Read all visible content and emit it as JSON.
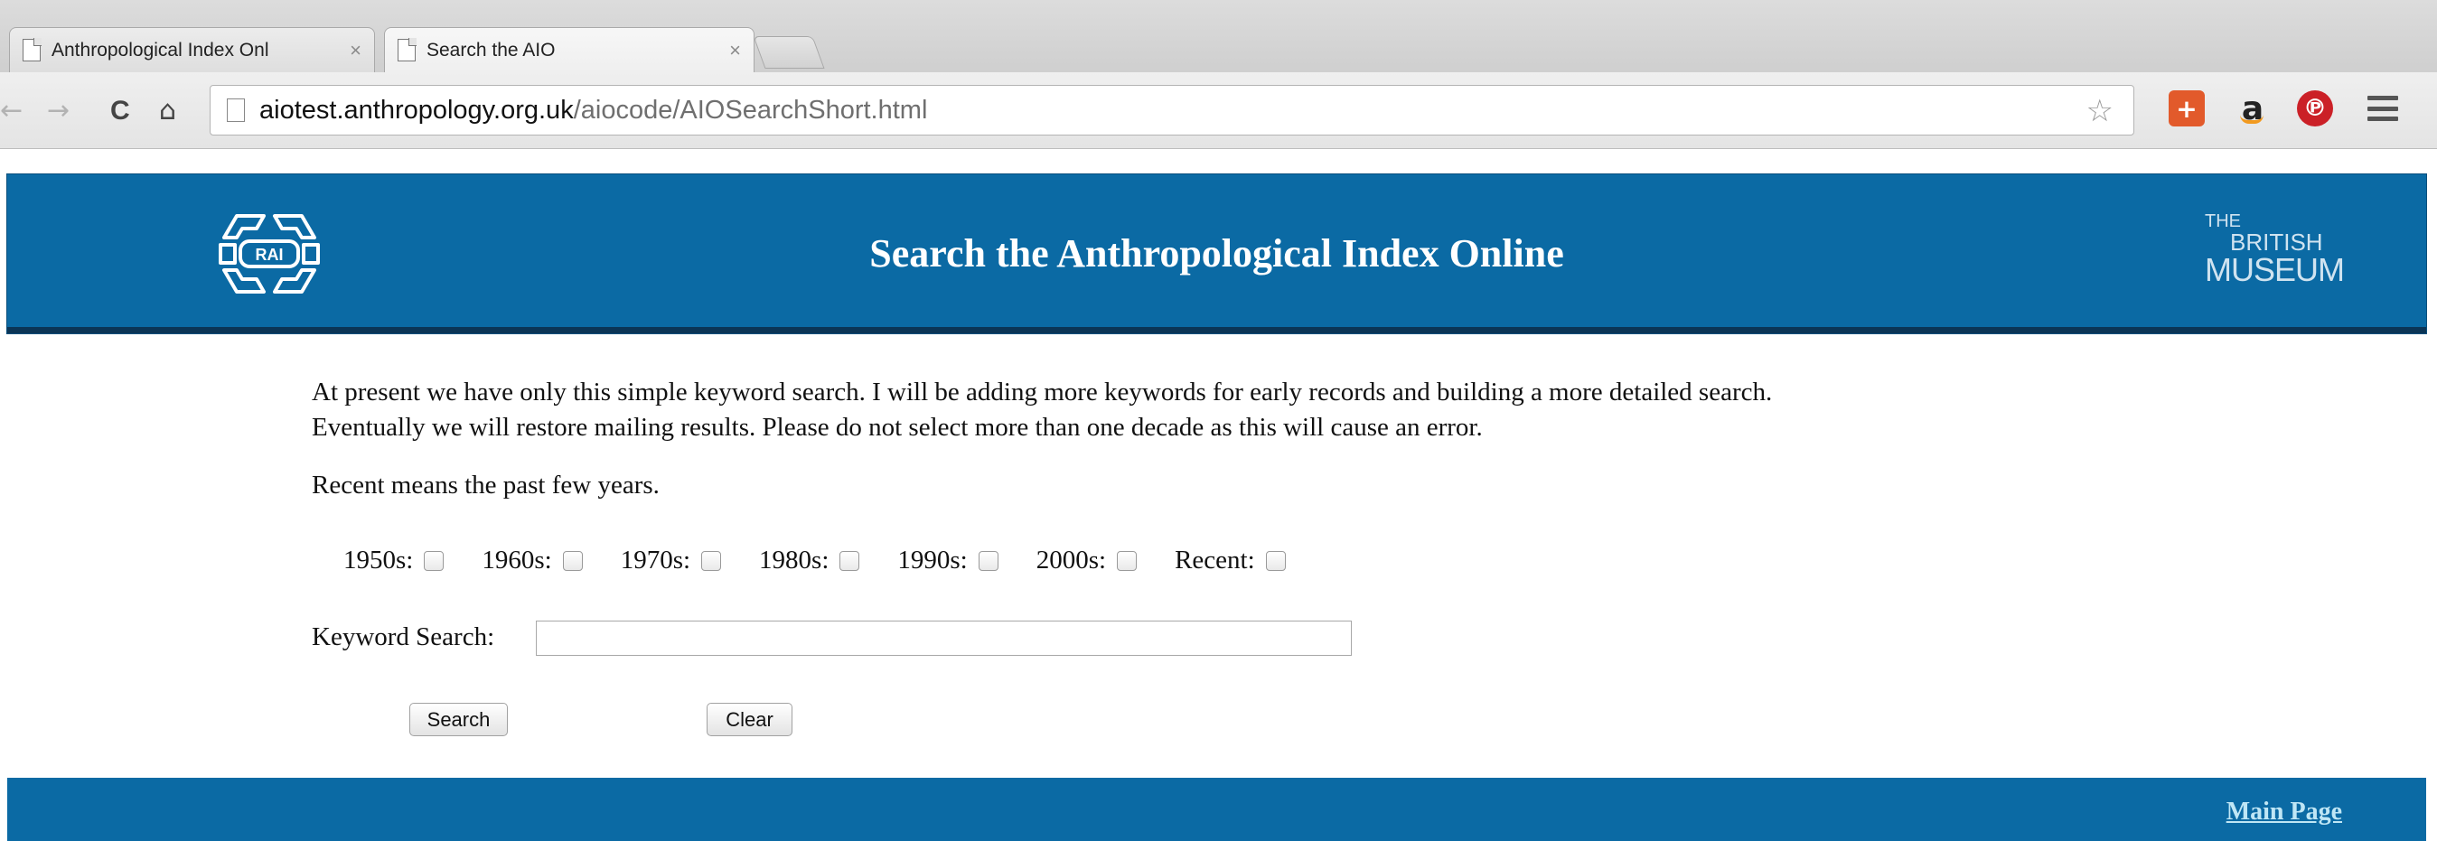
{
  "browser": {
    "tabs": [
      {
        "label": "Anthropological Index Onl",
        "active": false
      },
      {
        "label": "Search the AIO",
        "active": true
      }
    ],
    "close_glyph": "×",
    "url": {
      "host": "aiotest.anthropology.org.uk",
      "path": "/aiocode/AIOSearchShort.html"
    },
    "icons": {
      "back": "←",
      "forward": "→",
      "reload": "C",
      "home": "⌂",
      "star": "☆",
      "plus_ext": "+",
      "amazon_ext": "a",
      "pinterest_ext": "℗"
    }
  },
  "header": {
    "title": "Search the Anthropological Index Online",
    "logo_text": "RAI",
    "partner": {
      "the": "THE",
      "british": "BRITISH",
      "museum": "MUSEUM"
    }
  },
  "main": {
    "intro_line1": "At present we have only this simple keyword search. I will be adding more keywords for early records and building a more detailed search.",
    "intro_line2": "Eventually we will restore mailing results. Please do not select more than one decade as this will cause an error.",
    "recent_note": "Recent means the past few years.",
    "decades": [
      "1950s:",
      "1960s:",
      "1970s:",
      "1980s:",
      "1990s:",
      "2000s:",
      "Recent:"
    ],
    "keyword_label": "Keyword Search:",
    "keyword_value": "",
    "search_label": "Search",
    "clear_label": "Clear"
  },
  "footer": {
    "main_page_link": "Main Page"
  },
  "colors": {
    "header_bg": "#0b6aa4",
    "header_border": "#0b3556",
    "link": "#bfe6f5"
  }
}
